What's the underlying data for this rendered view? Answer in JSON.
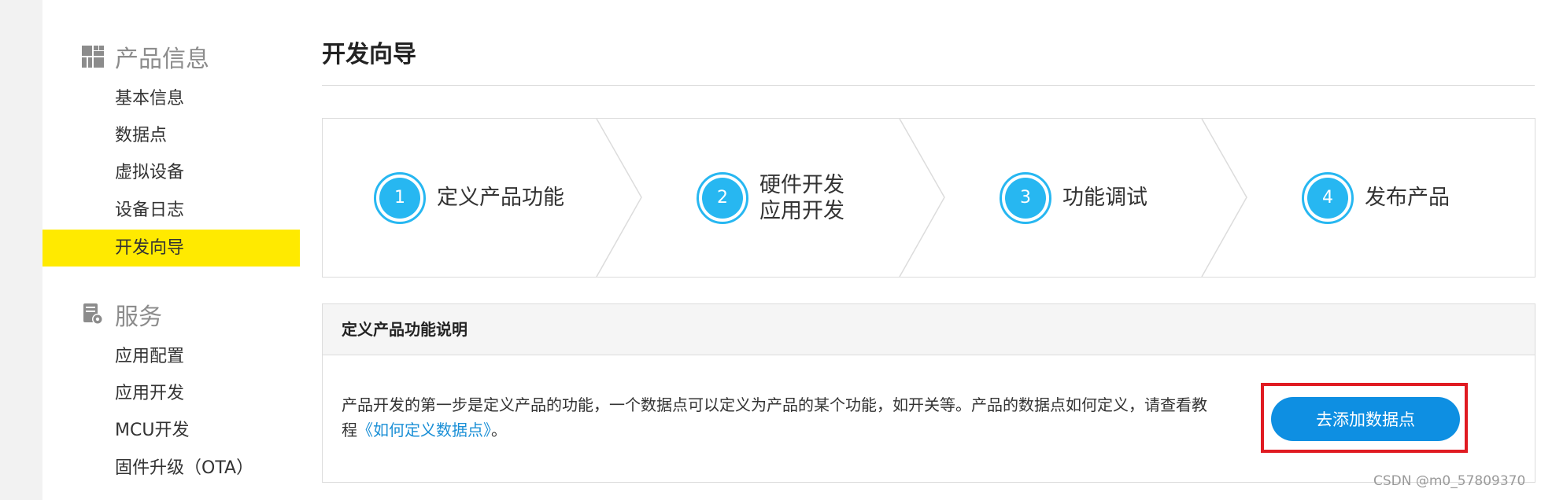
{
  "sidebar": {
    "sections": [
      {
        "title": "产品信息",
        "icon": "dashboard-icon",
        "items": [
          "基本信息",
          "数据点",
          "虚拟设备",
          "设备日志",
          "开发向导"
        ]
      },
      {
        "title": "服务",
        "icon": "service-settings-icon",
        "items": [
          "应用配置",
          "应用开发",
          "MCU开发",
          "固件升级（OTA）"
        ]
      }
    ],
    "active_item": "开发向导"
  },
  "main": {
    "page_title": "开发向导",
    "steps": [
      {
        "number": "1",
        "label_lines": [
          "定义产品功能"
        ]
      },
      {
        "number": "2",
        "label_lines": [
          "硬件开发",
          "应用开发"
        ]
      },
      {
        "number": "3",
        "label_lines": [
          "功能调试"
        ]
      },
      {
        "number": "4",
        "label_lines": [
          "发布产品"
        ]
      }
    ],
    "panel": {
      "title": "定义产品功能说明",
      "text_before_link": "产品开发的第一步是定义产品的功能，一个数据点可以定义为产品的某个功能，如开关等。产品的数据点如何定义，请查看教程",
      "link_text": "《如何定义数据点》",
      "text_after_link": "。",
      "action_button": "去添加数据点"
    }
  },
  "watermark": "CSDN @m0_57809370",
  "colors": {
    "accent_blue": "#27b7f1",
    "button_blue": "#0e8fe2",
    "active_yellow": "#ffea00",
    "highlight_red": "#e01b22",
    "link_blue": "#1a8fd6"
  }
}
